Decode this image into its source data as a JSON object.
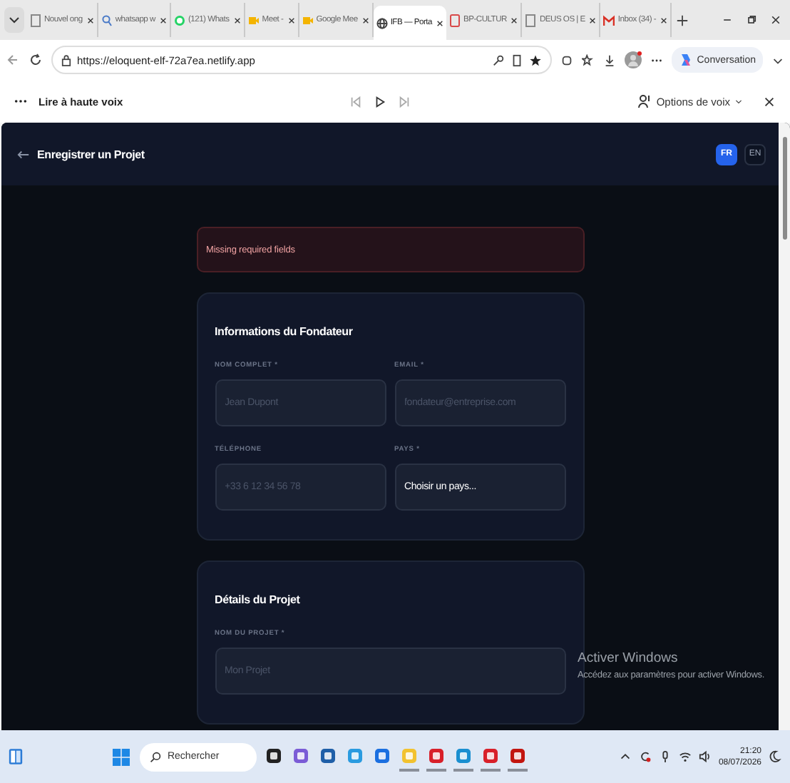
{
  "tabs": [
    {
      "title": "Nouvel ong",
      "kind": "page",
      "selected": false
    },
    {
      "title": "whatsapp w",
      "kind": "search",
      "selected": false
    },
    {
      "title": "(121) Whats",
      "kind": "chat",
      "selected": false
    },
    {
      "title": "Meet - ",
      "kind": "camera",
      "selected": false
    },
    {
      "title": "Google Mee",
      "kind": "camera",
      "selected": false
    },
    {
      "title": "IFB — Porta",
      "kind": "globe",
      "selected": true
    },
    {
      "title": "BP-CULTUR",
      "kind": "pdf",
      "selected": false
    },
    {
      "title": "DEUS OS | E",
      "kind": "page",
      "selected": false
    },
    {
      "title": "Inbox (34) -",
      "kind": "mail",
      "selected": false
    }
  ],
  "address": {
    "url": "https://eloquent-elf-72a7ea.netlify.app",
    "assistant": "Conversation"
  },
  "reader": {
    "title": "Lire à haute voix",
    "options": "Options de voix"
  },
  "header": {
    "title": "Enregistrer un Projet",
    "languages": [
      {
        "label": "FR",
        "selected": true
      },
      {
        "label": "EN",
        "selected": false
      }
    ]
  },
  "alert": "Missing required fields",
  "sections": [
    {
      "title": "Informations du Fondateur",
      "fields": [
        {
          "kind": "input",
          "label": "NOM COMPLET *",
          "placeholder": "Jean Dupont"
        },
        {
          "kind": "input",
          "label": "EMAIL *",
          "placeholder": "fondateur@entreprise.com"
        },
        {
          "kind": "input",
          "label": "TÉLÉPHONE",
          "placeholder": "+33 6 12 34 56 78"
        },
        {
          "kind": "select",
          "label": "PAYS *",
          "value": "Choisir un pays..."
        }
      ]
    },
    {
      "title": "Détails du Projet",
      "fields": [
        {
          "kind": "input",
          "label": "NOM DU PROJET *",
          "placeholder": "Mon Projet"
        }
      ]
    }
  ],
  "activation": {
    "title": "Activer Windows",
    "text": "Accédez aux paramètres pour activer Windows."
  },
  "taskbar": {
    "search": "Rechercher",
    "apps": [
      {
        "running": false
      },
      {
        "running": false
      },
      {
        "running": false
      },
      {
        "running": false
      },
      {
        "running": false
      },
      {
        "running": true
      },
      {
        "running": true
      },
      {
        "running": true
      },
      {
        "running": true
      },
      {
        "running": true
      }
    ],
    "time": "21:20",
    "date": "08/07/2026"
  }
}
